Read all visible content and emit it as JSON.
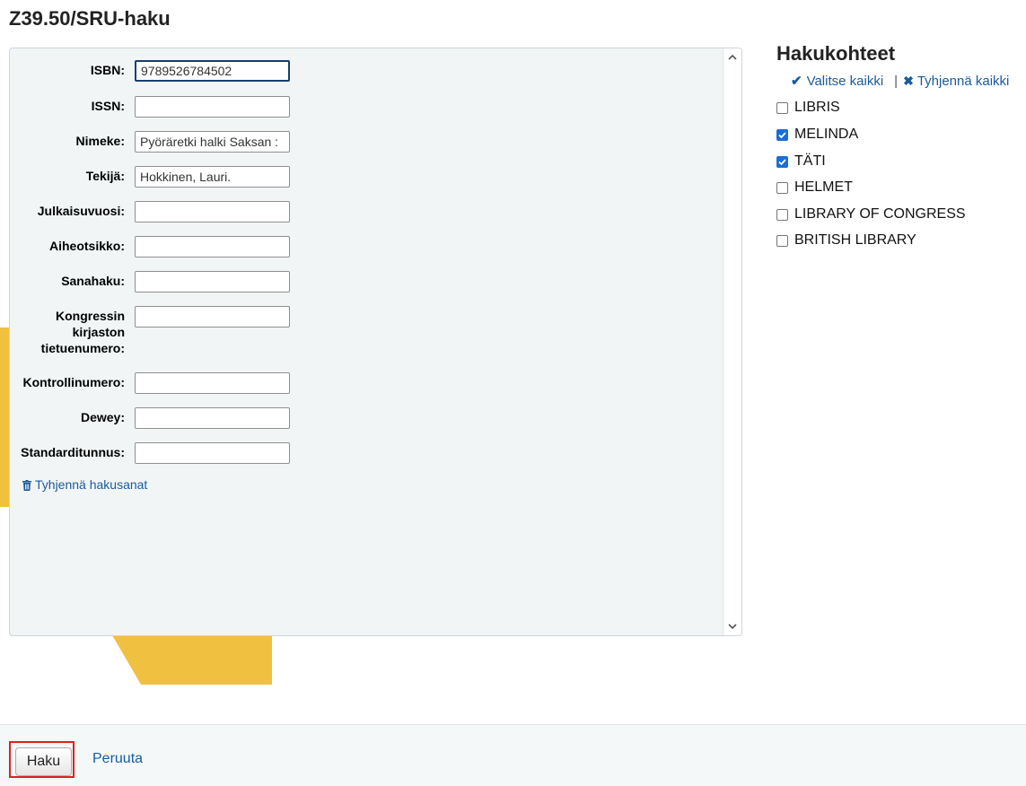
{
  "page": {
    "title": "Z39.50/SRU-haku"
  },
  "search_form": {
    "fields": [
      {
        "key": "isbn",
        "label": "ISBN:",
        "value": "9789526784502"
      },
      {
        "key": "issn",
        "label": "ISSN:",
        "value": ""
      },
      {
        "key": "nimeke",
        "label": "Nimeke:",
        "value": "Pyöräretki halki Saksan :"
      },
      {
        "key": "tekija",
        "label": "Tekijä:",
        "value": "Hokkinen, Lauri."
      },
      {
        "key": "julkaisuvuosi",
        "label": "Julkaisuvuosi:",
        "value": ""
      },
      {
        "key": "aiheotsikko",
        "label": "Aiheotsikko:",
        "value": ""
      },
      {
        "key": "sanahaku",
        "label": "Sanahaku:",
        "value": ""
      },
      {
        "key": "lccn",
        "label_lines": [
          "Kongressin",
          "kirjaston",
          "tietuenumero:"
        ],
        "value": ""
      },
      {
        "key": "kontrollinumero",
        "label": "Kontrollinumero:",
        "value": ""
      },
      {
        "key": "dewey",
        "label": "Dewey:",
        "value": ""
      },
      {
        "key": "standarditunnus",
        "label": "Standarditunnus:",
        "value": ""
      }
    ],
    "clear_terms_label": "Tyhjennä hakusanat"
  },
  "targets": {
    "title": "Hakukohteet",
    "select_all_label": "Valitse kaikki",
    "separator": "|",
    "clear_all_label": "Tyhjennä kaikki",
    "items": [
      {
        "label": "LIBRIS",
        "checked": false
      },
      {
        "label": "MELINDA",
        "checked": true
      },
      {
        "label": "TÄTI",
        "checked": true
      },
      {
        "label": "HELMET",
        "checked": false
      },
      {
        "label": "LIBRARY OF CONGRESS",
        "checked": false
      },
      {
        "label": "BRITISH LIBRARY",
        "checked": false
      }
    ]
  },
  "footer": {
    "search_button_label": "Haku",
    "cancel_label": "Peruuta"
  },
  "colors": {
    "link": "#1a5b9c",
    "checkbox_checked": "#1a6fd6",
    "highlight_border": "#e02020",
    "accent_yellow": "#f0c040"
  }
}
